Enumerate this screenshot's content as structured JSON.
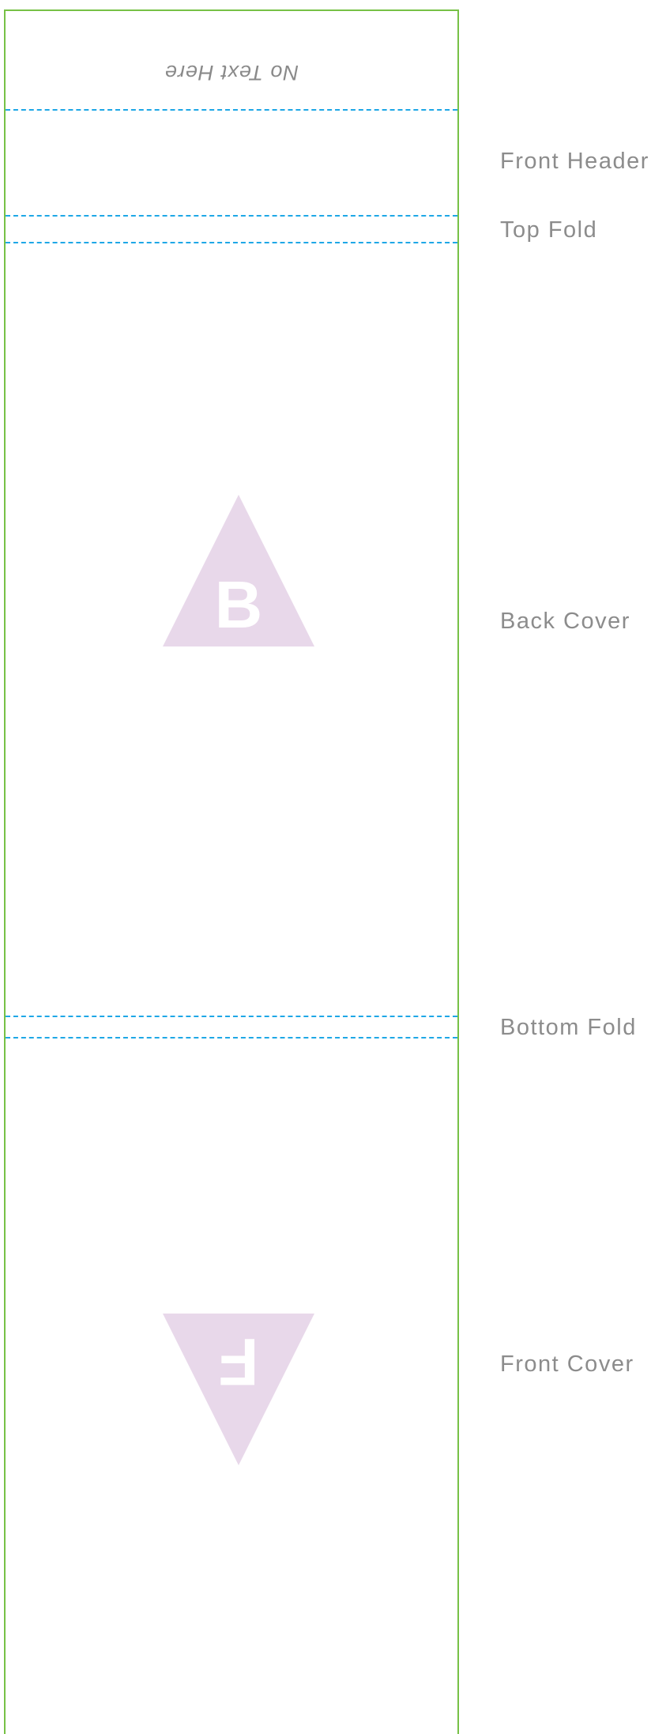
{
  "template": {
    "panel_border_color": "#77c146",
    "fold_line_color": "#1ea7e6",
    "marker_color": "#e8d8ea",
    "note_text": "No Text Here"
  },
  "labels": {
    "front_header": "Front Header",
    "top_fold": "Top Fold",
    "back_cover": "Back Cover",
    "bottom_fold": "Bottom Fold",
    "front_cover": "Front Cover"
  },
  "markers": {
    "back_letter": "B",
    "front_letter": "F"
  }
}
